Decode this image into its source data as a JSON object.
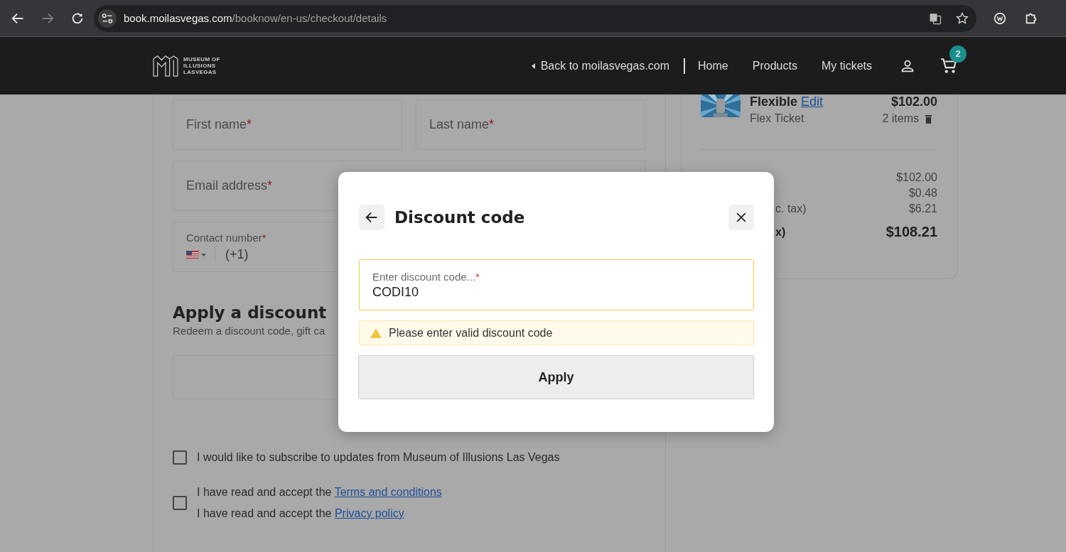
{
  "browser": {
    "url_host": "book.moilasvegas.com",
    "url_path": "/booknow/en-us/checkout/details",
    "forward_disabled": true
  },
  "header": {
    "logo_lines": [
      "MUSEUM OF",
      "ILLUSIONS",
      "LASVEGAS"
    ],
    "back_link": "Back to moilasvegas.com",
    "nav": [
      "Home",
      "Products",
      "My tickets"
    ],
    "cart_count": "2"
  },
  "form": {
    "name_fields": [
      {
        "label": "First name",
        "required_mark": "*"
      },
      {
        "label": "Last name",
        "required_mark": "*"
      }
    ],
    "email": {
      "label": "Email address",
      "required_mark": "*"
    },
    "contact": {
      "label": "Contact number",
      "required_mark": "*",
      "dial_code": "(+1)"
    },
    "discount": {
      "title": "Apply a discount",
      "subtitle": "Redeem a discount code, gift ca"
    },
    "checkboxes": [
      {
        "checked": false,
        "lines": [
          {
            "text": "I would like to subscribe to updates from Museum of Illusions Las Vegas"
          }
        ]
      },
      {
        "checked": false,
        "lines": [
          {
            "text": "I have read and accept the ",
            "link": "Terms and conditions"
          },
          {
            "text": "I have read and accept the ",
            "link": "Privacy policy"
          }
        ]
      }
    ]
  },
  "summary": {
    "item": {
      "name": "Flexible",
      "edit": "Edit",
      "price": "$102.00",
      "type": "Flex Ticket",
      "qty": "2 items"
    },
    "rows": [
      {
        "kind": "normal",
        "value": "$102.00"
      },
      {
        "kind": "normal",
        "value": "$0.48"
      },
      {
        "kind": "normal",
        "label": "c. tax)",
        "value": "$6.21"
      },
      {
        "kind": "total",
        "label": "x)",
        "value": "$108.21"
      }
    ]
  },
  "modal": {
    "title": "Discount code",
    "field": {
      "label": "Enter discount code...",
      "required_mark": "*",
      "value": "CODI10"
    },
    "warning": "Please enter valid discount code",
    "button": "Apply"
  }
}
